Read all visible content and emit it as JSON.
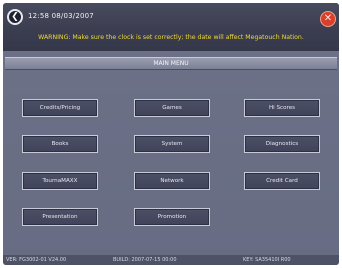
{
  "topbar": {
    "back_icon": "back-arrow-icon",
    "datetime": "12:58 08/03/2007",
    "close_icon": "close-icon",
    "warning": "WARNING: Make sure the clock is set correctly; the date will affect Megatouch Nation."
  },
  "main_menu": {
    "title": "MAIN MENU",
    "buttons": [
      {
        "label": "Credits/Pricing"
      },
      {
        "label": "Games"
      },
      {
        "label": "Hi Scores"
      },
      {
        "label": "Books"
      },
      {
        "label": "System"
      },
      {
        "label": "Diagnostics"
      },
      {
        "label": "TournaMAXX"
      },
      {
        "label": "Network"
      },
      {
        "label": "Credit Card"
      },
      {
        "label": "Presentation"
      },
      {
        "label": "Promotion"
      }
    ]
  },
  "footer": {
    "version": "VER: FG3002-01 V24.00",
    "build": "BUILD: 2007-07-15 00:00",
    "key": "KEY: SA35410I R00"
  },
  "colors": {
    "warning_text": "#f0d838",
    "close_button": "#d8402a",
    "background": "#6a6f86"
  }
}
